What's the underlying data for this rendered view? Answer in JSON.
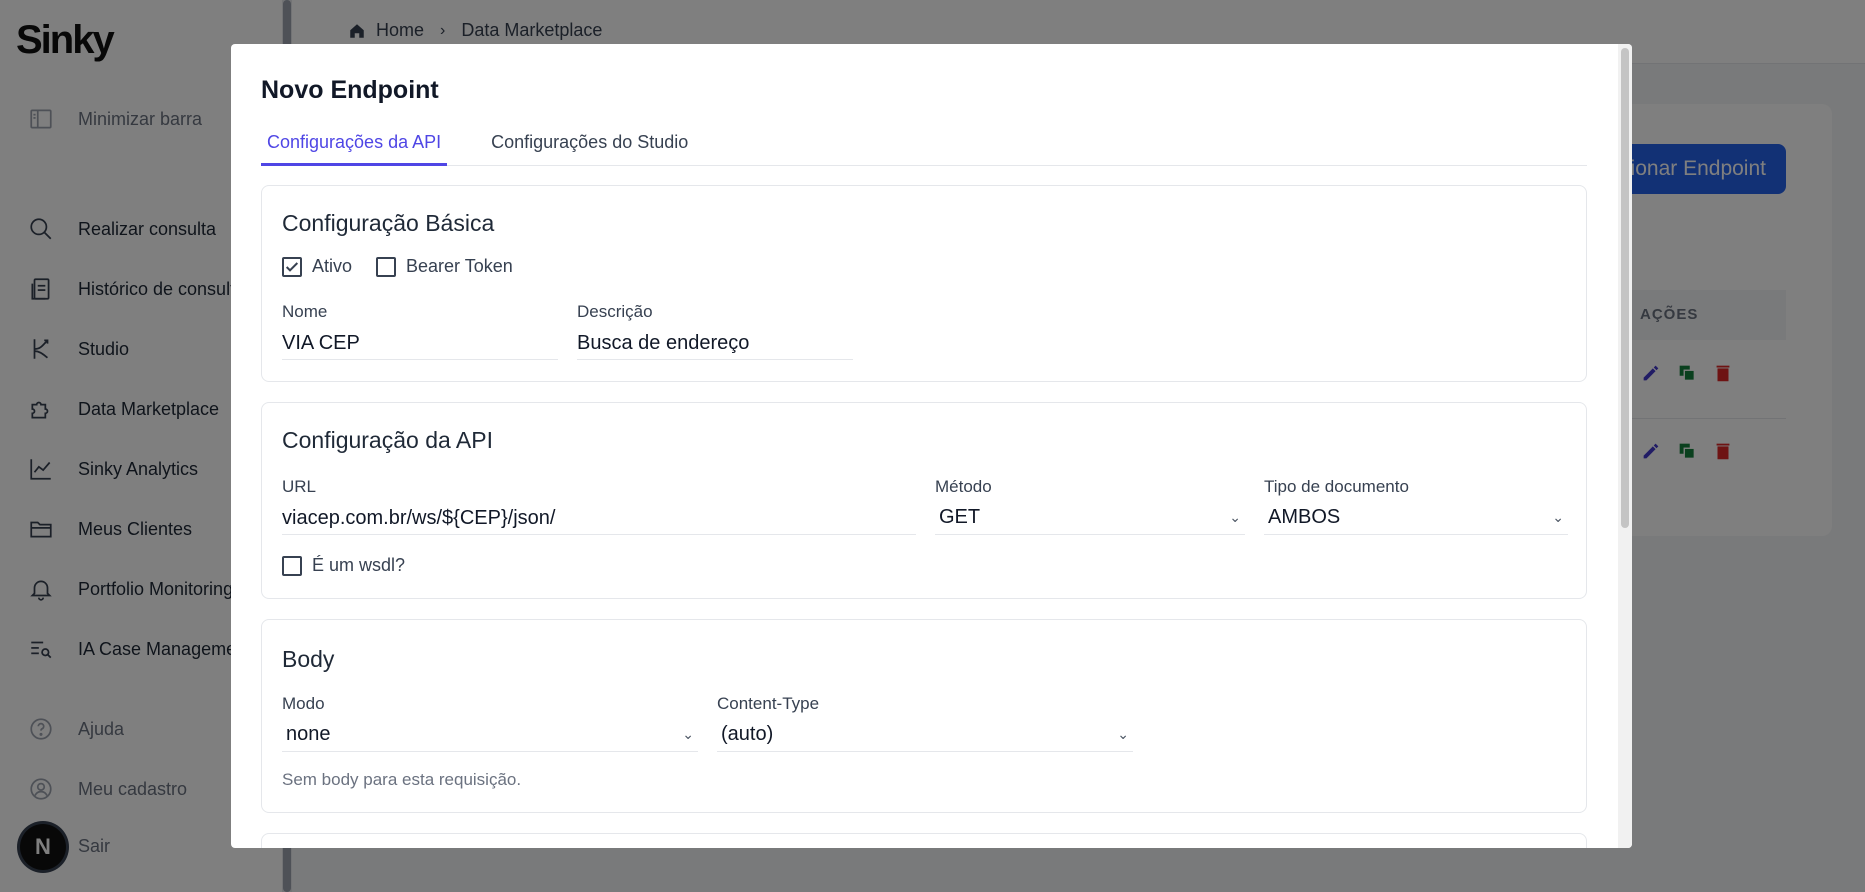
{
  "app": {
    "logo": "Sinky"
  },
  "sidebar": {
    "items": [
      {
        "label": "Minimizar barra",
        "icon": "sidebar-collapse-icon"
      },
      {
        "label": "Realizar consulta",
        "icon": "search-icon"
      },
      {
        "label": "Histórico de consultas",
        "icon": "document-history-icon"
      },
      {
        "label": "Studio",
        "icon": "branch-icon"
      },
      {
        "label": "Data Marketplace",
        "icon": "puzzle-icon"
      },
      {
        "label": "Sinky Analytics",
        "icon": "chart-line-icon"
      },
      {
        "label": "Meus Clientes",
        "icon": "folder-icon"
      },
      {
        "label": "Portfolio Monitoring",
        "icon": "bell-icon"
      },
      {
        "label": "IA Case Management",
        "icon": "list-search-icon"
      },
      {
        "label": "Ajuda",
        "icon": "help-icon"
      },
      {
        "label": "Meu cadastro",
        "icon": "user-icon"
      },
      {
        "label": "Sair",
        "icon": "logout-icon"
      }
    ],
    "avatar_letter": "N"
  },
  "breadcrumb": {
    "home": "Home",
    "current": "Data Marketplace"
  },
  "page": {
    "add_button": "Adicionar Endpoint",
    "table_header_actions": "AÇÕES"
  },
  "modal": {
    "title": "Novo Endpoint",
    "tabs": [
      {
        "label": "Configurações da API",
        "active": true
      },
      {
        "label": "Configurações do Studio",
        "active": false
      }
    ],
    "basic": {
      "title": "Configuração Básica",
      "ativo_label": "Ativo",
      "ativo_checked": true,
      "bearer_label": "Bearer Token",
      "bearer_checked": false,
      "nome_label": "Nome",
      "nome_value": "VIA CEP",
      "descricao_label": "Descrição",
      "descricao_value": "Busca de endereço"
    },
    "api": {
      "title": "Configuração da API",
      "url_label": "URL",
      "url_value": "viacep.com.br/ws/${CEP}/json/",
      "metodo_label": "Método",
      "metodo_value": "GET",
      "tipo_label": "Tipo de documento",
      "tipo_value": "AMBOS",
      "wsdl_label": "É um wsdl?",
      "wsdl_checked": false
    },
    "body": {
      "title": "Body",
      "modo_label": "Modo",
      "modo_value": "none",
      "content_type_label": "Content-Type",
      "content_type_value": "(auto)",
      "hint": "Sem body para esta requisição."
    }
  },
  "colors": {
    "accent": "#4f46e5",
    "primary_button": "#2563eb",
    "edit_icon": "#4338ca",
    "copy_icon": "#15803d",
    "delete_icon": "#dc2626"
  }
}
